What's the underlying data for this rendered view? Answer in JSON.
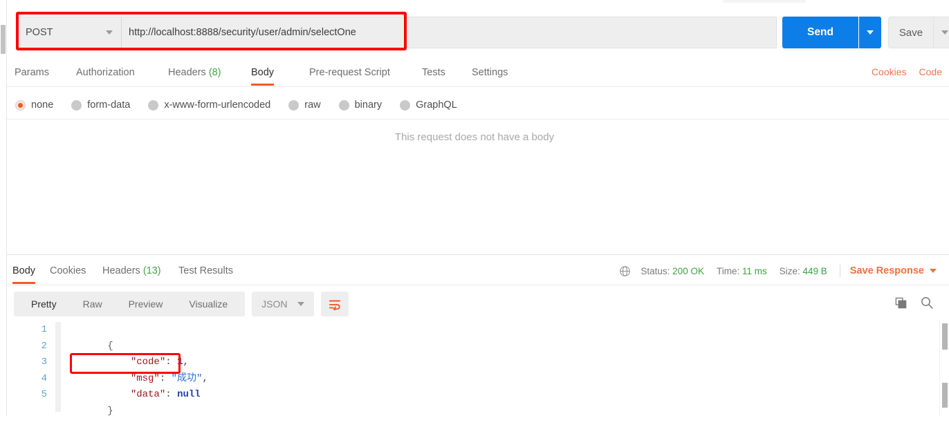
{
  "request": {
    "method": "POST",
    "url": "http://localhost:8888/security/user/admin/selectOne",
    "send_label": "Send",
    "save_label": "Save",
    "tabs": [
      {
        "label": "Params",
        "count": ""
      },
      {
        "label": "Authorization",
        "count": ""
      },
      {
        "label": "Headers",
        "count": "(8)"
      },
      {
        "label": "Body",
        "count": ""
      },
      {
        "label": "Pre-request Script",
        "count": ""
      },
      {
        "label": "Tests",
        "count": ""
      },
      {
        "label": "Settings",
        "count": ""
      }
    ],
    "active_tab": "Body",
    "right_links": [
      "Cookies",
      "Code"
    ],
    "body_types": [
      {
        "label": "none",
        "selected": true
      },
      {
        "label": "form-data",
        "selected": false
      },
      {
        "label": "x-www-form-urlencoded",
        "selected": false
      },
      {
        "label": "raw",
        "selected": false
      },
      {
        "label": "binary",
        "selected": false
      },
      {
        "label": "GraphQL",
        "selected": false
      }
    ],
    "empty_body_message": "This request does not have a body"
  },
  "response": {
    "tabs": [
      {
        "label": "Body",
        "count": ""
      },
      {
        "label": "Cookies",
        "count": ""
      },
      {
        "label": "Headers",
        "count": "(13)"
      },
      {
        "label": "Test Results",
        "count": ""
      }
    ],
    "active_tab": "Body",
    "status_label": "Status:",
    "status_value": "200 OK",
    "time_label": "Time:",
    "time_value": "11 ms",
    "size_label": "Size:",
    "size_value": "449 B",
    "save_response_label": "Save Response",
    "view_modes": [
      "Pretty",
      "Raw",
      "Preview",
      "Visualize"
    ],
    "active_view_mode": "Pretty",
    "format": "JSON",
    "line_numbers": [
      "1",
      "2",
      "3",
      "4",
      "5"
    ],
    "json": {
      "open_brace": "{",
      "code_key": "\"code\"",
      "code_value": "1",
      "msg_key": "\"msg\"",
      "msg_value": "\"成功\"",
      "data_key": "\"data\"",
      "data_value": "null",
      "close_brace": "}",
      "colon": ": ",
      "comma": ","
    }
  },
  "colors": {
    "accent_orange": "#ef5b25",
    "send_blue": "#0d7ee8",
    "status_green": "#3fa142",
    "annotation_red": "#fe0000",
    "link_orange": "#f1703f"
  }
}
